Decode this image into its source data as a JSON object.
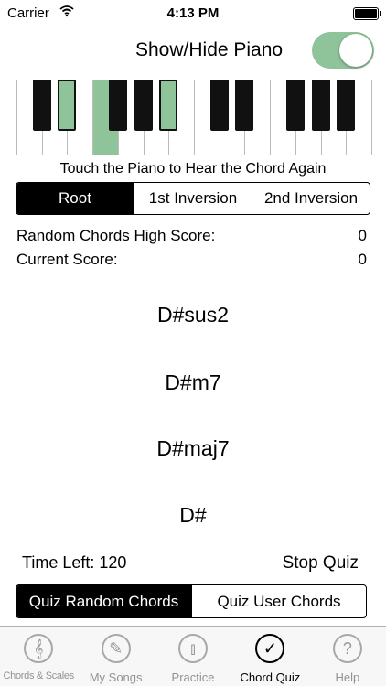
{
  "status_bar": {
    "carrier": "Carrier",
    "time": "4:13 PM"
  },
  "piano_toggle": {
    "label": "Show/Hide Piano",
    "on": true
  },
  "piano": {
    "hint": "Touch the Piano to Hear the Chord Again",
    "highlight_color": "#8fc39a",
    "highlighted_white_keys": [
      3
    ],
    "highlighted_black_keys": [
      1,
      4
    ]
  },
  "inversion": {
    "options": [
      "Root",
      "1st Inversion",
      "2nd Inversion"
    ],
    "selected": "Root"
  },
  "scores": {
    "high_score_label": "Random Chords High Score:",
    "high_score": "0",
    "current_label": "Current Score:",
    "current": "0"
  },
  "choices": [
    "D#sus2",
    "D#m7",
    "D#maj7",
    "D#"
  ],
  "quiz": {
    "time_left_label": "Time Left:",
    "time_left": "120",
    "stop_label": "Stop Quiz",
    "modes": [
      "Quiz Random Chords",
      "Quiz User Chords"
    ],
    "selected_mode": "Quiz Random Chords"
  },
  "tabs": [
    {
      "label": "Chords & Scales",
      "icon": "treble-clef-icon",
      "glyph": "𝄞"
    },
    {
      "label": "My Songs",
      "icon": "pencil-icon",
      "glyph": "✎"
    },
    {
      "label": "Practice",
      "icon": "metronome-icon",
      "glyph": "⫾"
    },
    {
      "label": "Chord Quiz",
      "icon": "checkmark-icon",
      "glyph": "✓",
      "active": true
    },
    {
      "label": "Help",
      "icon": "question-icon",
      "glyph": "?"
    }
  ]
}
